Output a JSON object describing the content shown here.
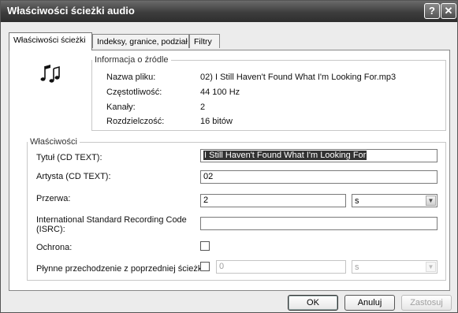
{
  "window": {
    "title": "Właściwości ścieżki audio",
    "help_label": "?",
    "close_label": "✕"
  },
  "tabs": [
    {
      "label": "Właściwości ścieżki",
      "active": true
    },
    {
      "label": "Indeksy, granice, podział",
      "active": false
    },
    {
      "label": "Filtry",
      "active": false
    }
  ],
  "source_info": {
    "legend": "Informacja o źródle",
    "icon": "music-notes-icon",
    "rows": [
      {
        "label": "Nazwa pliku:",
        "value": "02) I Still Haven't Found What I'm Looking For.mp3"
      },
      {
        "label": "Częstotliwość:",
        "value": "44 100 Hz"
      },
      {
        "label": "Kanały:",
        "value": "2"
      },
      {
        "label": "Rozdzielczość:",
        "value": "16 bitów"
      }
    ]
  },
  "properties": {
    "legend": "Właściwości",
    "title_label": "Tytuł (CD TEXT):",
    "title_value": "I Still Haven't Found What I'm Looking For",
    "artist_label": "Artysta (CD TEXT):",
    "artist_value": "02",
    "pause_label": "Przerwa:",
    "pause_value": "2",
    "pause_unit": "s",
    "isrc_label": "International Standard Recording Code (ISRC):",
    "isrc_value": "",
    "protection_label": "Ochrona:",
    "protection_checked": false,
    "crossfade_label": "Płynne przechodzenie z poprzedniej ścieżki:",
    "crossfade_checked": false,
    "crossfade_value": "0",
    "crossfade_unit": "s"
  },
  "footer": {
    "ok_label": "OK",
    "cancel_label": "Anuluj",
    "apply_label": "Zastosuj"
  }
}
